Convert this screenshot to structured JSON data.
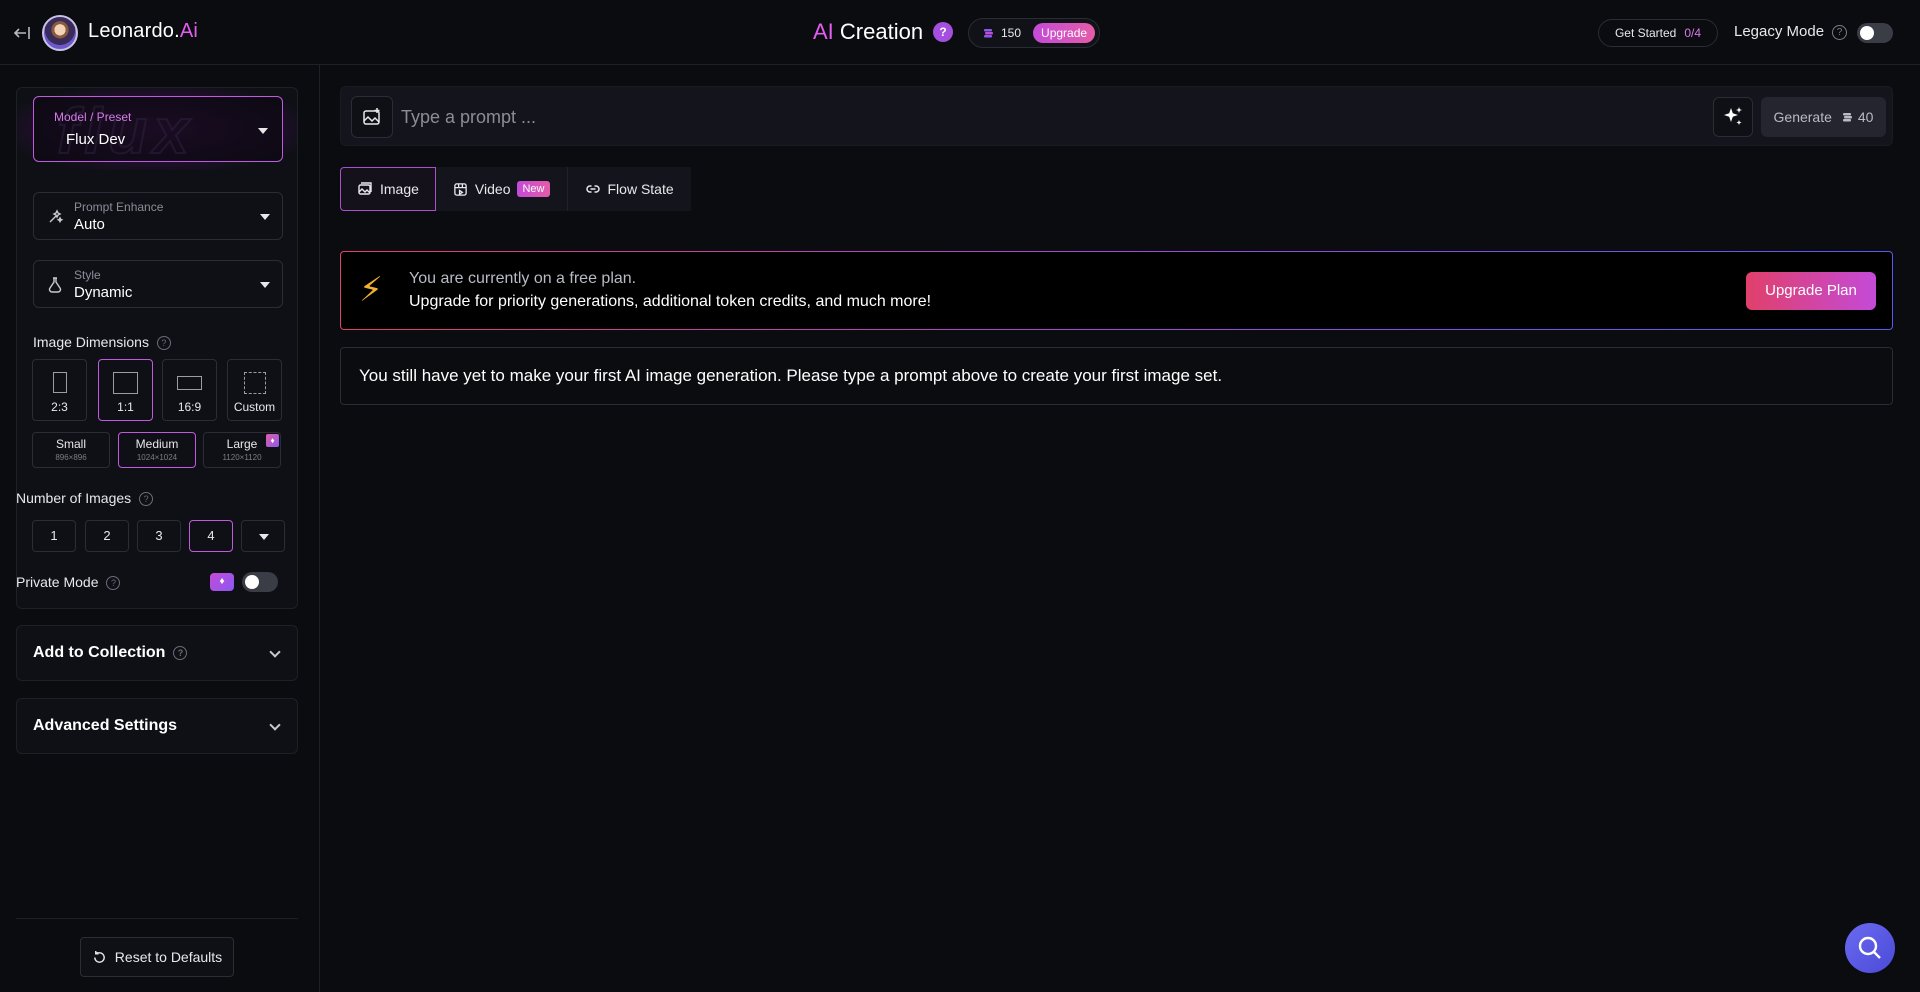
{
  "header": {
    "brand_name": "Leonardo.",
    "brand_ai": "Ai",
    "title_ai": "AI",
    "title_rest": " Creation",
    "help_glyph": "?",
    "credits": "150",
    "upgrade_label": "Upgrade",
    "get_started_label": "Get Started",
    "get_started_count": "0/4",
    "legacy_mode_label": "Legacy Mode",
    "legacy_help_glyph": "?"
  },
  "sidebar": {
    "model_preset": {
      "label": "Model / Preset",
      "value": "Flux Dev",
      "banner_art": "flux"
    },
    "prompt_enhance": {
      "label": "Prompt Enhance",
      "value": "Auto"
    },
    "style": {
      "label": "Style",
      "value": "Dynamic"
    },
    "image_dimensions": {
      "label": "Image Dimensions",
      "ratios": [
        {
          "label": "2:3"
        },
        {
          "label": "1:1",
          "active": true
        },
        {
          "label": "16:9"
        },
        {
          "label": "Custom"
        }
      ],
      "sizes": [
        {
          "label": "Small",
          "sub": "896×896"
        },
        {
          "label": "Medium",
          "sub": "1024×1024",
          "active": true
        },
        {
          "label": "Large",
          "sub": "1120×1120",
          "premium": true
        }
      ]
    },
    "number_of_images": {
      "label": "Number of Images",
      "options": [
        "1",
        "2",
        "3",
        "4"
      ],
      "selected": "4"
    },
    "private_mode": {
      "label": "Private Mode",
      "enabled": false
    },
    "add_to_collection_label": "Add to Collection",
    "advanced_settings_label": "Advanced Settings",
    "reset_label": "Reset to Defaults"
  },
  "main": {
    "prompt": {
      "value": "",
      "placeholder": "Type a prompt ..."
    },
    "generate": {
      "label": "Generate",
      "cost": "40"
    },
    "tabs": [
      {
        "label": "Image",
        "icon": "image-icon",
        "active": true
      },
      {
        "label": "Video",
        "icon": "video-icon",
        "badge": "New"
      },
      {
        "label": "Flow State",
        "icon": "link-icon"
      }
    ],
    "upgrade_banner": {
      "line1": "You are currently on a free plan.",
      "line2": "Upgrade for priority generations, additional token credits, and much more!",
      "button": "Upgrade Plan"
    },
    "empty_message": "You still have yet to make your first AI image generation. Please type a prompt above to create your first image set."
  },
  "colors": {
    "accent": "#c05ae0",
    "brand_pink": "#e45cf0",
    "background": "#0b0c10",
    "support_button": "#5a5ae8"
  }
}
